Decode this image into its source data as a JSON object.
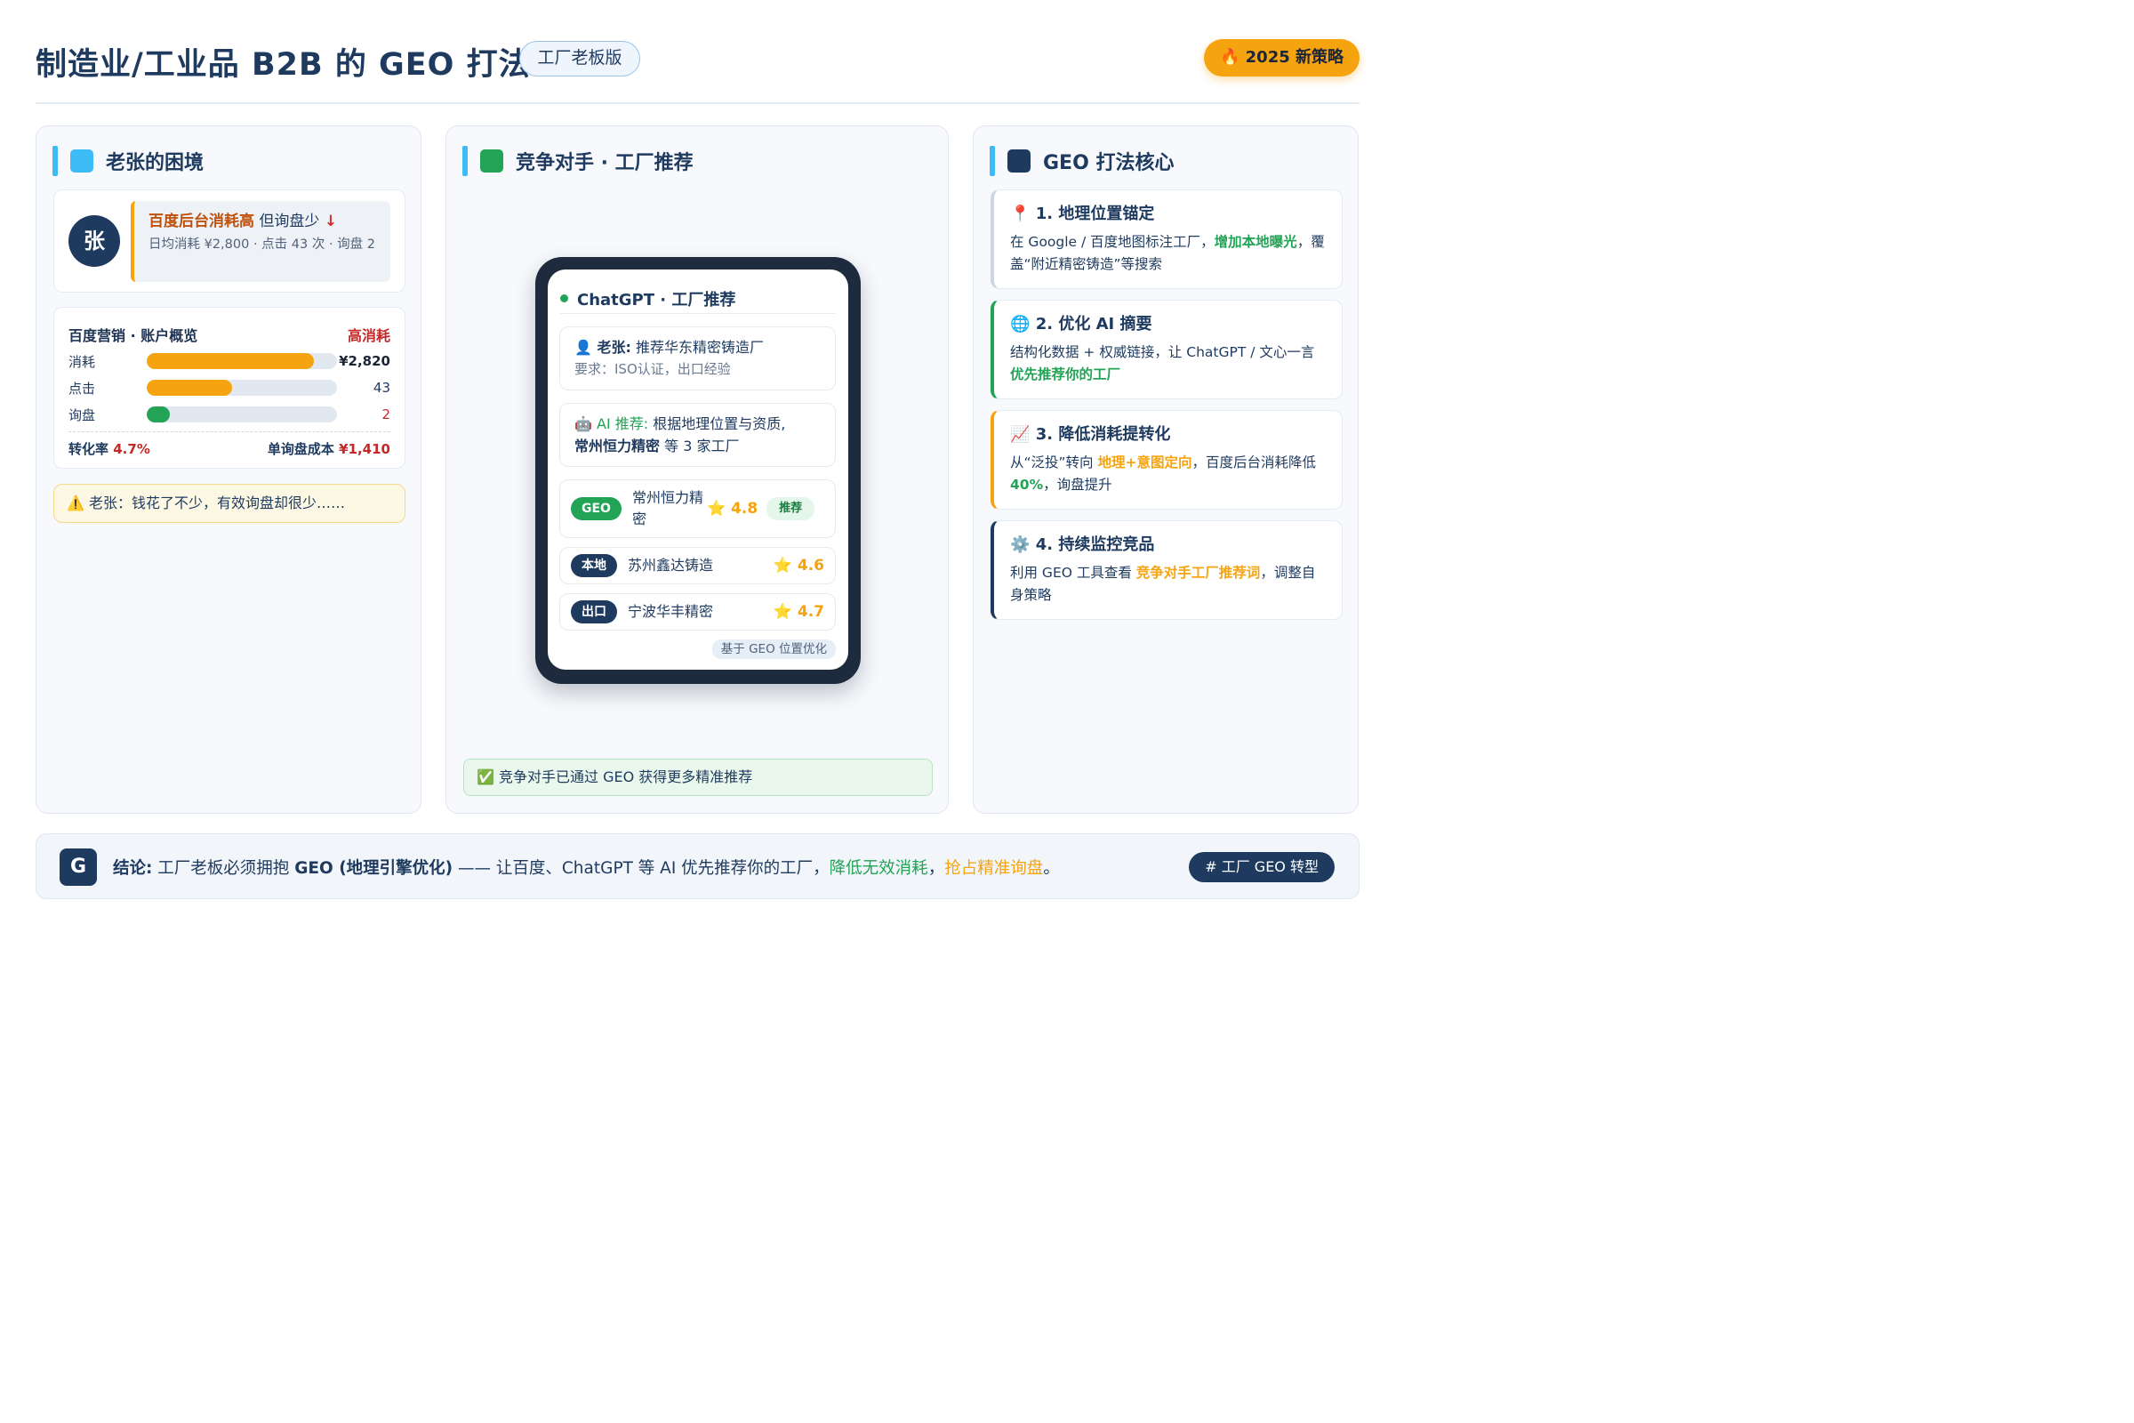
{
  "header": {
    "title": "制造业/工业品 B2B 的 GEO 打法",
    "edition_badge": "工厂老板版",
    "strategy_badge": "🔥 2025 新策略"
  },
  "colors": {
    "navy": "#1e3a5f",
    "accent_orange": "#f5a30f",
    "accent_green": "#22a355",
    "accent_blue": "#3dbbf5",
    "alert_red": "#c62828"
  },
  "panel_problem": {
    "title": "老张的困境",
    "avatar": "张",
    "quote_highlight": "百度后台消耗高",
    "quote_rest": "但询盘少",
    "quote_arrow": "↓",
    "quote_detail": "日均消耗 ¥2,800 · 点击 43 次 · 询盘 2",
    "account": {
      "title": "百度营销 · 账户概览",
      "status": "高消耗",
      "rows": [
        {
          "label": "消耗",
          "value": "¥2,820",
          "fill": 0.88,
          "color": "#f5a30f"
        },
        {
          "label": "点击",
          "value": "43",
          "fill": 0.45,
          "color": "#f5a30f"
        },
        {
          "label": "询盘",
          "value": "2",
          "fill": 0.12,
          "color": "#22a355"
        }
      ],
      "conversion_label": "转化率",
      "conversion_value": "4.7%",
      "cost_label": "单询盘成本",
      "cost_value": "¥1,410"
    },
    "warning": "⚠️ 老张：钱花了不少，有效询盘却很少……"
  },
  "panel_competitor": {
    "title": "竞争对手 · 工厂推荐",
    "phone": {
      "app_title": "ChatGPT · 工厂推荐",
      "user_label": "👤 老张:",
      "user_query": "推荐华东精密铸造厂",
      "user_req": "要求：ISO认证，出口经验",
      "ai_label": "🤖 AI 推荐:",
      "ai_text": "根据地理位置与资质,",
      "ai_highlight": "常州恒力精密",
      "ai_tail": "等 3 家工厂",
      "results": [
        {
          "tag": "GEO",
          "tag_color": "#22a355",
          "name": "常州恒力精密",
          "score": "⭐ 4.8",
          "badge": "推荐"
        },
        {
          "tag": "本地",
          "tag_color": "#1e3a5f",
          "name": "苏州鑫达铸造",
          "score": "⭐ 4.6",
          "badge": ""
        },
        {
          "tag": "出口",
          "tag_color": "#1e3a5f",
          "name": "宁波华丰精密",
          "score": "⭐ 4.7",
          "badge": ""
        }
      ],
      "note": "基于 GEO 位置优化"
    },
    "footer": "✅ 竞争对手已通过 GEO 获得更多精准推荐"
  },
  "panel_core": {
    "title": "GEO 打法核心",
    "tips": [
      {
        "icon": "📍",
        "title": "1. 地理位置锚定",
        "pre": "在 Google / 百度地图标注工厂，",
        "hl": "增加本地曝光",
        "post": "，覆盖“附近精密铸造”等搜索",
        "hl_color": "green",
        "border": "#cdd6e0"
      },
      {
        "icon": "🌐",
        "title": "2. 优化 AI 摘要",
        "pre": "结构化数据 + 权威链接，让 ChatGPT / 文心一言 ",
        "hl": "优先推荐你的工厂",
        "post": "",
        "hl_color": "green",
        "border": "#22a355"
      },
      {
        "icon": "📈",
        "title": "3. 降低消耗提转化",
        "pre": "从“泛投”转向 ",
        "hl": "地理+意图定向",
        "post": "，百度后台消耗降低 ",
        "hl2": "40%",
        "post2": "，询盘提升",
        "hl_color": "orange",
        "border": "#f5a30f"
      },
      {
        "icon": "⚙️",
        "title": "4. 持续监控竞品",
        "pre": "利用 GEO 工具查看 ",
        "hl": "竞争对手工厂推荐词",
        "post": "，调整自身策略",
        "hl_color": "orange",
        "border": "#1e3a5f"
      }
    ]
  },
  "footer": {
    "logo": "G",
    "label": "结论:",
    "text1": "工厂老板必须拥抱",
    "bold": "GEO (地理引擎优化)",
    "text2": "—— 让百度、ChatGPT 等 AI 优先推荐你的工厂，",
    "green": "降低无效消耗",
    "sep": "，",
    "orange": "抢占精准询盘",
    "end": "。",
    "tag": "# 工厂 GEO 转型"
  }
}
